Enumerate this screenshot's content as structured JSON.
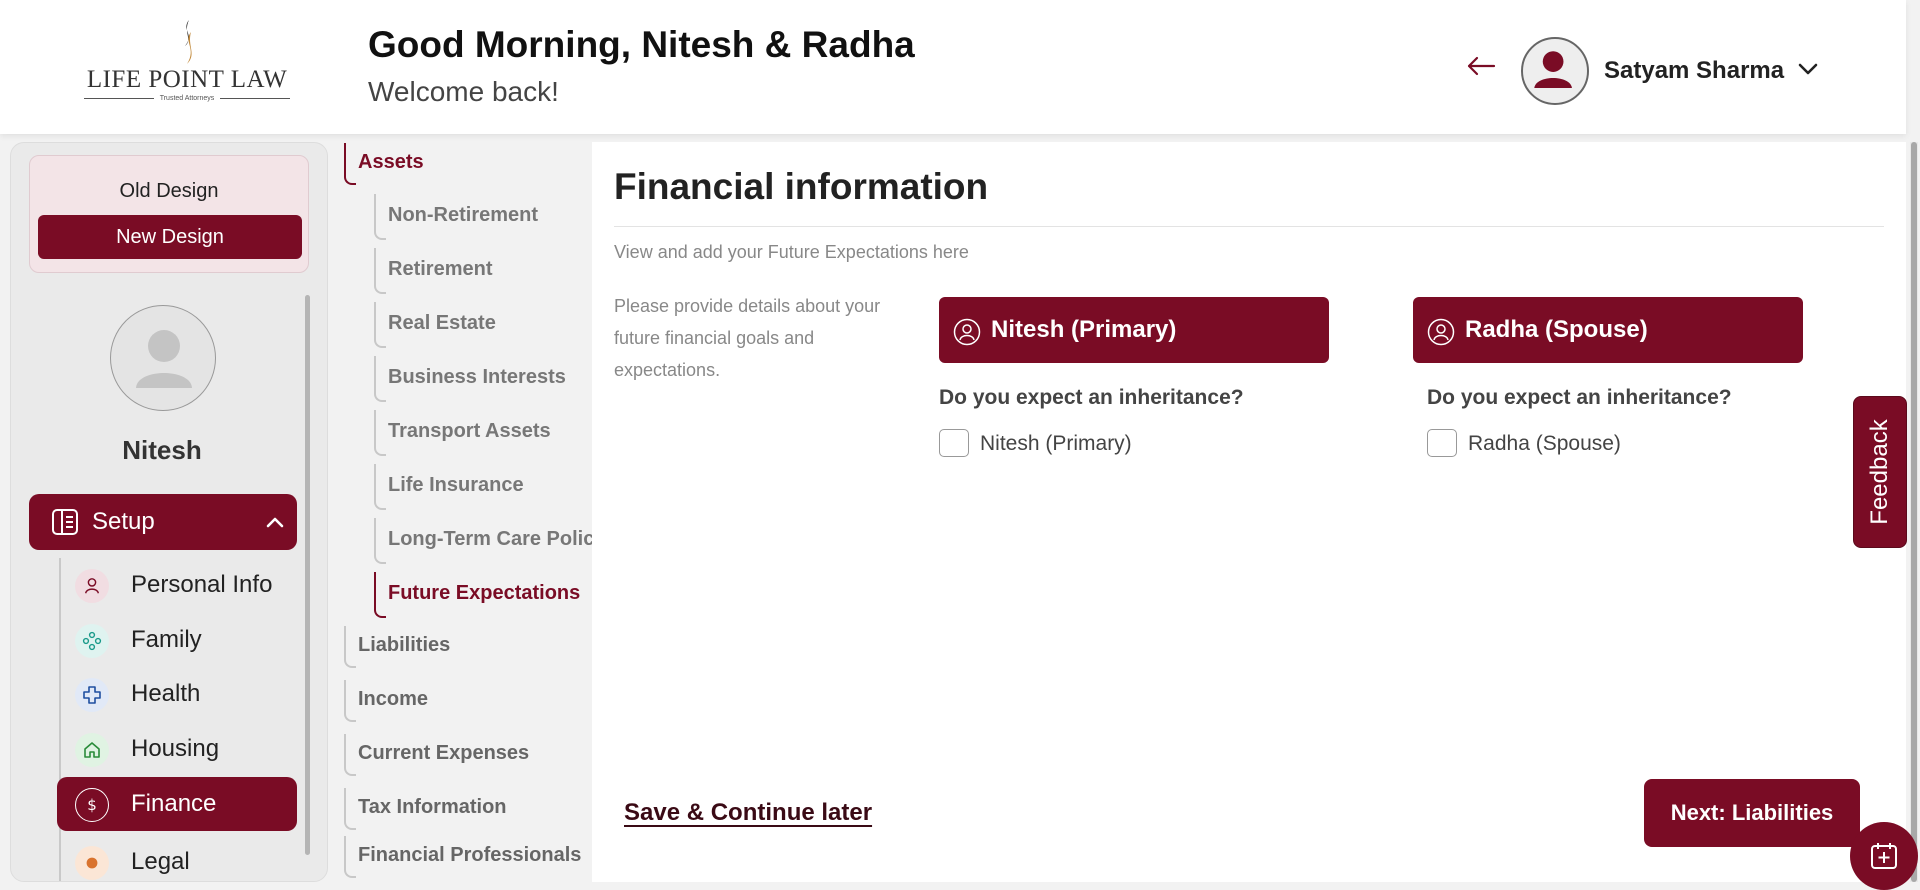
{
  "header": {
    "logo_text": "LIFE POINT LAW",
    "logo_tagline": "Trusted Attorneys",
    "greeting": "Good Morning, Nitesh & Radha",
    "welcome": "Welcome back!",
    "user_name": "Satyam Sharma"
  },
  "sidebar": {
    "old_design": "Old Design",
    "new_design": "New Design",
    "profile_name": "Nitesh",
    "setup_label": "Setup",
    "items": [
      {
        "label": "Personal Info",
        "icon": "person-icon"
      },
      {
        "label": "Family",
        "icon": "family-icon"
      },
      {
        "label": "Health",
        "icon": "health-cross-icon"
      },
      {
        "label": "Housing",
        "icon": "home-icon"
      },
      {
        "label": "Finance",
        "icon": "dollar-icon",
        "active": true
      },
      {
        "label": "Legal",
        "icon": "legal-icon"
      }
    ]
  },
  "subnav": {
    "assets": "Assets",
    "children": [
      "Non-Retirement",
      "Retirement",
      "Real Estate",
      "Business Interests",
      "Transport Assets",
      "Life Insurance",
      "Long-Term Care Policy",
      "Future Expectations"
    ],
    "active_child": "Future Expectations",
    "sections": [
      "Liabilities",
      "Income",
      "Current Expenses",
      "Tax Information",
      "Financial Professionals"
    ]
  },
  "main": {
    "title": "Financial information",
    "subtitle": "View and add your Future Expectations here",
    "description": "Please provide details about your future financial goals and expectations.",
    "primary": {
      "card_label": "Nitesh (Primary)",
      "question": "Do you expect an inheritance?",
      "checkbox_label": "Nitesh (Primary)",
      "checked": false
    },
    "spouse": {
      "card_label": "Radha (Spouse)",
      "question": "Do you expect an inheritance?",
      "checkbox_label": "Radha (Spouse)",
      "checked": false
    },
    "save_later": "Save & Continue later",
    "next_button": "Next: Liabilities"
  },
  "feedback_label": "Feedback",
  "colors": {
    "brand": "#7a0c25",
    "background": "#f2f2f2"
  }
}
